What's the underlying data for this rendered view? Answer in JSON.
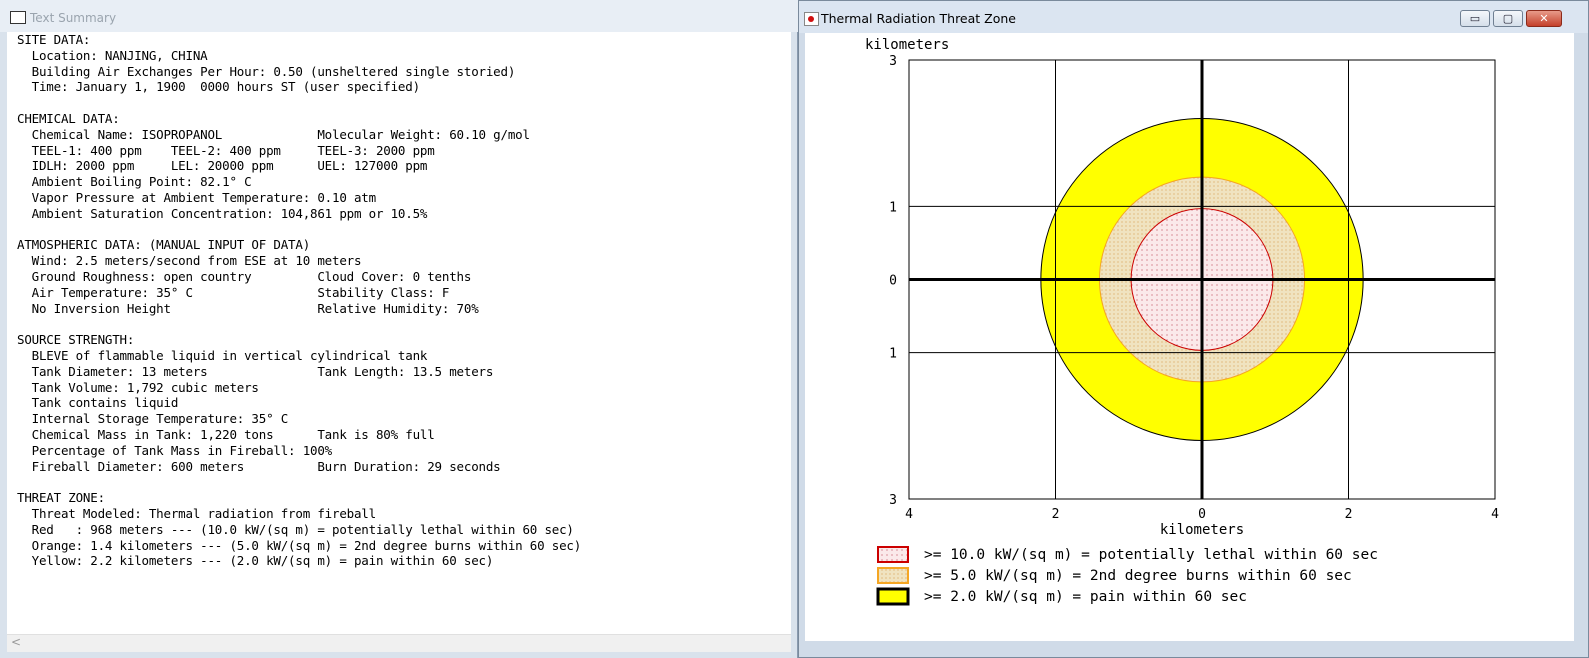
{
  "text_summary": {
    "window_title": "Text Summary",
    "body": "SITE DATA:\n  Location: NANJING, CHINA\n  Building Air Exchanges Per Hour: 0.50 (unsheltered single storied)\n  Time: January 1, 1900  0000 hours ST (user specified)\n\nCHEMICAL DATA:\n  Chemical Name: ISOPROPANOL             Molecular Weight: 60.10 g/mol\n  TEEL-1: 400 ppm    TEEL-2: 400 ppm     TEEL-3: 2000 ppm\n  IDLH: 2000 ppm     LEL: 20000 ppm      UEL: 127000 ppm\n  Ambient Boiling Point: 82.1° C\n  Vapor Pressure at Ambient Temperature: 0.10 atm\n  Ambient Saturation Concentration: 104,861 ppm or 10.5%\n\nATMOSPHERIC DATA: (MANUAL INPUT OF DATA)\n  Wind: 2.5 meters/second from ESE at 10 meters\n  Ground Roughness: open country         Cloud Cover: 0 tenths\n  Air Temperature: 35° C                 Stability Class: F\n  No Inversion Height                    Relative Humidity: 70%\n\nSOURCE STRENGTH:\n  BLEVE of flammable liquid in vertical cylindrical tank\n  Tank Diameter: 13 meters               Tank Length: 13.5 meters\n  Tank Volume: 1,792 cubic meters\n  Tank contains liquid\n  Internal Storage Temperature: 35° C\n  Chemical Mass in Tank: 1,220 tons      Tank is 80% full\n  Percentage of Tank Mass in Fireball: 100%\n  Fireball Diameter: 600 meters          Burn Duration: 29 seconds\n\nTHREAT ZONE:\n  Threat Modeled: Thermal radiation from fireball\n  Red   : 968 meters --- (10.0 kW/(sq m) = potentially lethal within 60 sec)\n  Orange: 1.4 kilometers --- (5.0 kW/(sq m) = 2nd degree burns within 60 sec)\n  Yellow: 2.2 kilometers --- (2.0 kW/(sq m) = pain within 60 sec)",
    "scroll_arrow": "<"
  },
  "threat_zone": {
    "window_title": "Thermal Radiation Threat Zone",
    "buttons": {
      "minimize": "▭",
      "maximize": "▢",
      "close": "✕"
    },
    "colors": {
      "red": "#cc0000",
      "orange": "#f5a623",
      "orange_fill": "#f0e3c0",
      "yellow": "#ffff00",
      "red_fill": "#fbe9ea"
    }
  },
  "chart_data": {
    "type": "area",
    "title": "",
    "ylabel": "kilometers",
    "xlabel": "kilometers",
    "xlim": [
      -4,
      4
    ],
    "ylim": [
      -3,
      3
    ],
    "x_tick_labels": [
      "4",
      "2",
      "0",
      "2",
      "4"
    ],
    "y_tick_labels": [
      "3",
      "1",
      "0",
      "1",
      "3"
    ],
    "grid": true,
    "zones": [
      {
        "name": "yellow",
        "radius_km": 2.2,
        "fill": "#ffff00",
        "stroke": "#000000"
      },
      {
        "name": "orange",
        "radius_km": 1.4,
        "fill": "#f0e3c0",
        "stroke": "#f5a623"
      },
      {
        "name": "red",
        "radius_km": 0.968,
        "fill": "#fbe9ea",
        "stroke": "#cc0000"
      }
    ],
    "legend": [
      {
        "swatch": "red",
        "label": ">= 10.0 kW/(sq m) = potentially lethal within 60 sec"
      },
      {
        "swatch": "orange",
        "label": ">= 5.0 kW/(sq m) = 2nd degree burns within 60 sec"
      },
      {
        "swatch": "yellow",
        "label": ">= 2.0 kW/(sq m) = pain within 60 sec"
      }
    ]
  }
}
